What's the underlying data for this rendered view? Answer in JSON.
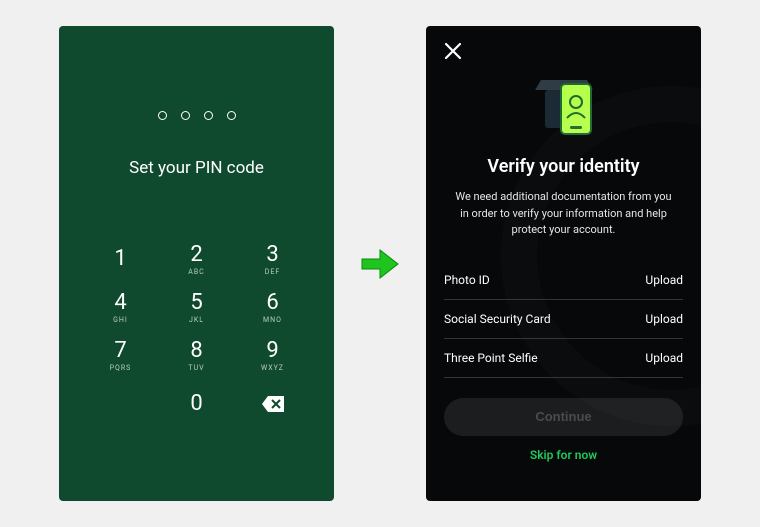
{
  "pin": {
    "title": "Set your PIN code",
    "dot_count": 4,
    "keys": [
      {
        "num": "1",
        "letters": ""
      },
      {
        "num": "2",
        "letters": "ABC"
      },
      {
        "num": "3",
        "letters": "DEF"
      },
      {
        "num": "4",
        "letters": "GHI"
      },
      {
        "num": "5",
        "letters": "JKL"
      },
      {
        "num": "6",
        "letters": "MNO"
      },
      {
        "num": "7",
        "letters": "PQRS"
      },
      {
        "num": "8",
        "letters": "TUV"
      },
      {
        "num": "9",
        "letters": "WXYZ"
      }
    ],
    "zero": {
      "num": "0",
      "letters": ""
    }
  },
  "verify": {
    "title": "Verify your identity",
    "description": "We need additional documentation from you in order to verify your information and help protect your account.",
    "docs": [
      {
        "label": "Photo ID",
        "action": "Upload"
      },
      {
        "label": "Social Security Card",
        "action": "Upload"
      },
      {
        "label": "Three Point Selfie",
        "action": "Upload"
      }
    ],
    "continue_label": "Continue",
    "skip_label": "Skip for now"
  }
}
